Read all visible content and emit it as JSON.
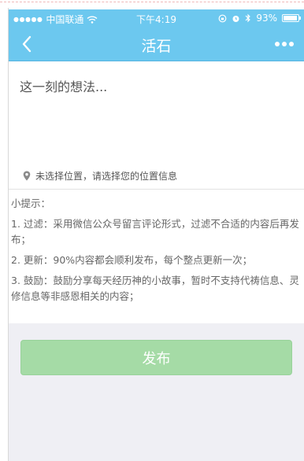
{
  "status_bar": {
    "carrier": "中国联通",
    "time": "下午4:19",
    "battery": "93%",
    "battery_level": 0.93
  },
  "nav": {
    "title": "活石",
    "back_icon": "chevron-left-icon",
    "more_icon": "more-dots-icon"
  },
  "composer": {
    "placeholder": "这一刻的想法...",
    "value": "",
    "location_text": "未选择位置，请选择您的位置信息",
    "location_icon": "location-pin-icon"
  },
  "tips": {
    "heading": "小提示：",
    "items": [
      "1. 过滤：采用微信公众号留言评论形式，过滤不合适的内容后再发布；",
      "2. 更新：90%内容都会顺利发布，每个整点更新一次；",
      "3. 鼓励：鼓励分享每天经历神的小故事，暂时不支持代祷信息、灵修信息等非感恩相关的内容；"
    ]
  },
  "actions": {
    "publish_label": "发布"
  },
  "colors": {
    "header": "#6cc8ef",
    "button": "#a5dba6",
    "bottom_bg": "#efeff4"
  }
}
